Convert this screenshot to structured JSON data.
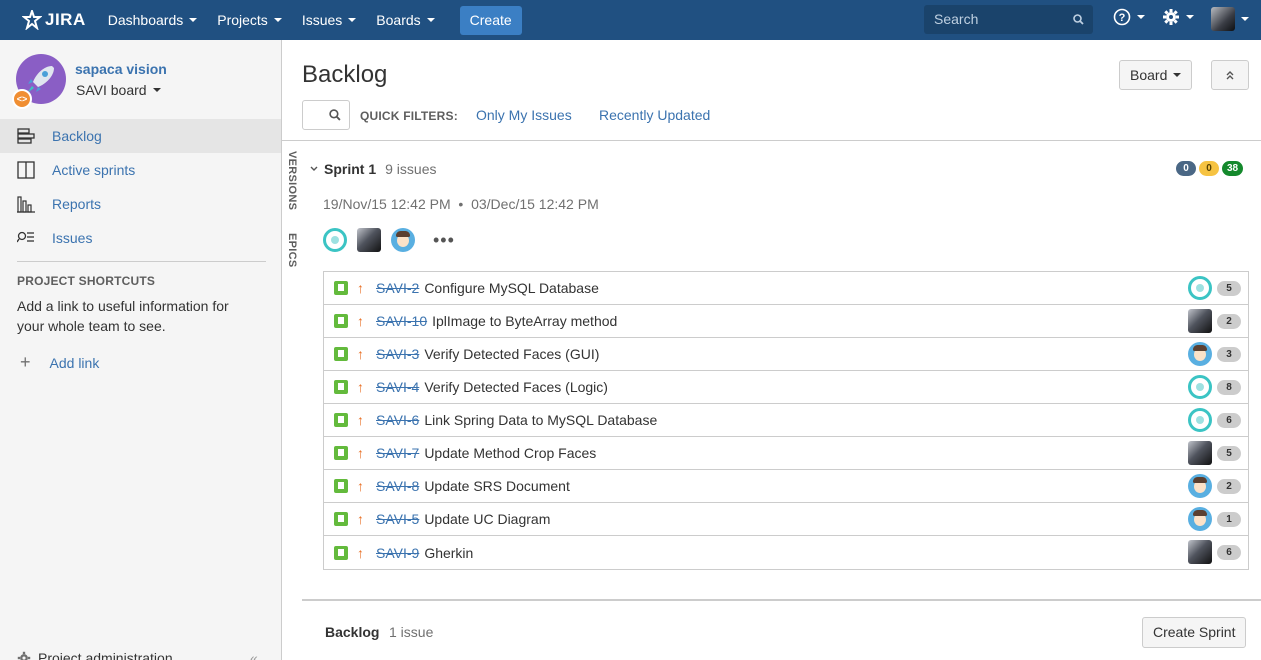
{
  "topnav": {
    "logo": "JIRA",
    "menu": [
      "Dashboards",
      "Projects",
      "Issues",
      "Boards"
    ],
    "create": "Create",
    "search_placeholder": "Search",
    "help_icon": "help-icon",
    "settings_icon": "gear-icon"
  },
  "sidebar": {
    "project_name": "sapaca vision",
    "board_name": "SAVI board",
    "nav": [
      {
        "label": "Backlog",
        "icon": "backlog-icon",
        "active": true
      },
      {
        "label": "Active sprints",
        "icon": "active-sprints-icon",
        "active": false
      },
      {
        "label": "Reports",
        "icon": "reports-icon",
        "active": false
      },
      {
        "label": "Issues",
        "icon": "issues-icon",
        "active": false
      }
    ],
    "shortcuts_title": "PROJECT SHORTCUTS",
    "shortcuts_text": "Add a link to useful information for your whole team to see.",
    "add_link": "Add link",
    "project_admin": "Project administration"
  },
  "main": {
    "title": "Backlog",
    "board_button": "Board",
    "quick_filters_label": "QUICK FILTERS:",
    "quick_filters": [
      "Only My Issues",
      "Recently Updated"
    ],
    "side_tabs": [
      "VERSIONS",
      "EPICS"
    ]
  },
  "sprint": {
    "name": "Sprint 1",
    "count": "9 issues",
    "dates": "19/Nov/15 12:42 PM  •  03/Dec/15 12:42 PM",
    "badges": [
      {
        "value": "0",
        "color": "#4a6785"
      },
      {
        "value": "0",
        "color": "#f6c342"
      },
      {
        "value": "38",
        "color": "#14892c"
      }
    ],
    "more": "•••",
    "issues": [
      {
        "key": "SAVI-2",
        "summary": "Configure MySQL Database",
        "assignee": "smile",
        "estimate": "5"
      },
      {
        "key": "SAVI-10",
        "summary": "IplImage to ByteArray method",
        "assignee": "horse",
        "estimate": "2"
      },
      {
        "key": "SAVI-3",
        "summary": "Verify Detected Faces (GUI)",
        "assignee": "man",
        "estimate": "3"
      },
      {
        "key": "SAVI-4",
        "summary": "Verify Detected Faces (Logic)",
        "assignee": "smile",
        "estimate": "8"
      },
      {
        "key": "SAVI-6",
        "summary": "Link Spring Data to MySQL Database",
        "assignee": "smile",
        "estimate": "6"
      },
      {
        "key": "SAVI-7",
        "summary": "Update Method Crop Faces",
        "assignee": "horse",
        "estimate": "5"
      },
      {
        "key": "SAVI-8",
        "summary": "Update SRS Document",
        "assignee": "man",
        "estimate": "2"
      },
      {
        "key": "SAVI-5",
        "summary": "Update UC Diagram",
        "assignee": "man",
        "estimate": "1"
      },
      {
        "key": "SAVI-9",
        "summary": "Gherkin",
        "assignee": "horse",
        "estimate": "6"
      }
    ]
  },
  "backlog": {
    "title": "Backlog",
    "count": "1 issue",
    "create_sprint": "Create Sprint"
  }
}
